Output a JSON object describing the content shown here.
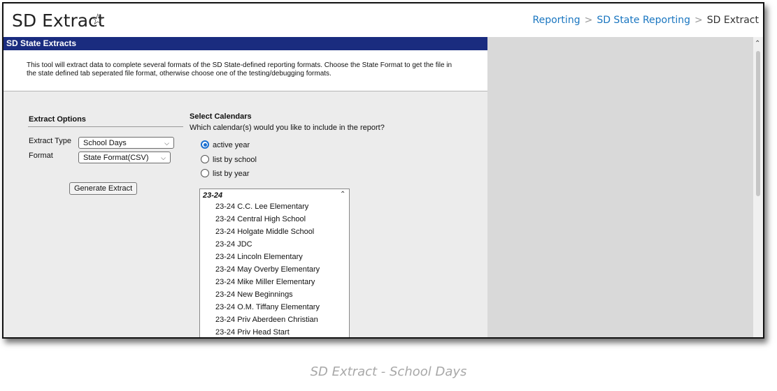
{
  "header": {
    "title": "SD Extract",
    "breadcrumb": [
      "Reporting",
      "SD State Reporting",
      "SD Extract"
    ]
  },
  "section": {
    "title": "SD State Extracts",
    "description": "This tool will extract data to complete several formats of the SD State-defined reporting formats. Choose the State Format to get the file in the state defined tab seperated file format, otherwise choose one of the testing/debugging formats."
  },
  "extract_options": {
    "heading": "Extract Options",
    "extract_type_label": "Extract Type",
    "extract_type_value": "School Days",
    "format_label": "Format",
    "format_value": "State Format(CSV)",
    "generate_button": "Generate Extract"
  },
  "calendars": {
    "heading": "Select Calendars",
    "question": "Which calendar(s) would you like to include in the report?",
    "options": [
      "active year",
      "list by school",
      "list by year"
    ],
    "selected": "active year",
    "group": "23-24",
    "items": [
      "23-24 C.C. Lee Elementary",
      "23-24 Central High School",
      "23-24 Holgate Middle School",
      "23-24 JDC",
      "23-24 Lincoln Elementary",
      "23-24 May Overby Elementary",
      "23-24 Mike Miller Elementary",
      "23-24 New Beginnings",
      "23-24 O.M. Tiffany Elementary",
      "23-24 Priv Aberdeen Christian",
      "23-24 Priv Head Start"
    ]
  },
  "caption": "SD Extract - School Days",
  "colors": {
    "section_header_bg": "#1a2c7f",
    "link": "#1a76c0",
    "radio_selected": "#1a6fd0"
  }
}
